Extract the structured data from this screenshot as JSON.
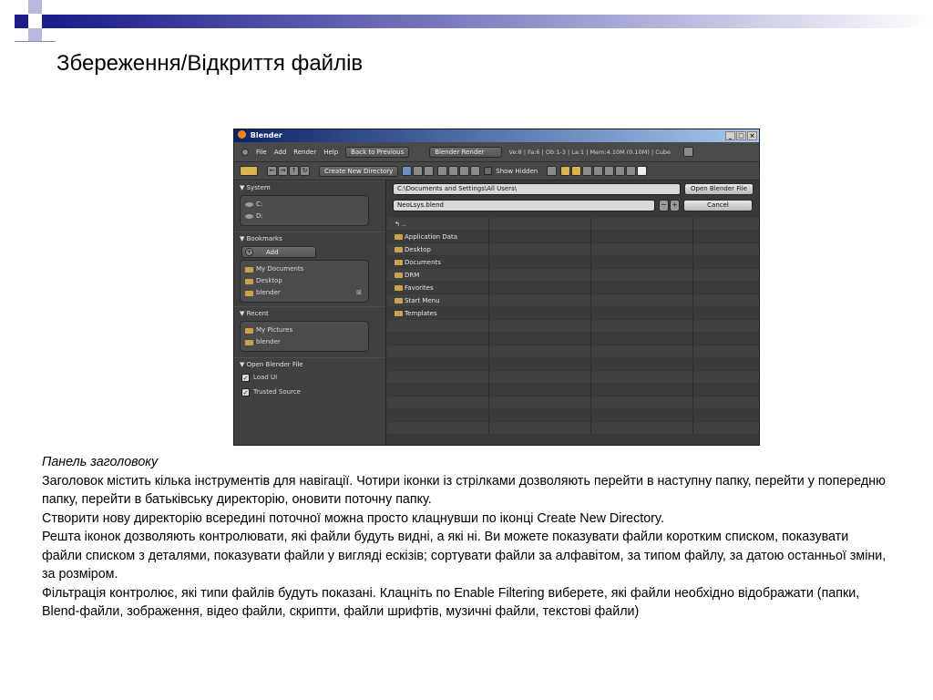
{
  "slide": {
    "title": "Збереження/Відкриття  файлів"
  },
  "window": {
    "title": "Blender",
    "controls": [
      "_",
      "□",
      "×"
    ],
    "menu": {
      "items": [
        "File",
        "Add",
        "Render",
        "Help"
      ],
      "back_button": "Back to Previous",
      "engine": "Blender Render",
      "stats": "Ve:8 | Fa:6 | Ob:1-3 | La:1 | Mem:4.10M (0.10M) | Cube"
    },
    "toolbar": {
      "create_dir_label": "Create New Directory",
      "show_hidden_label": "Show Hidden"
    },
    "sidebar": {
      "system_header": "System",
      "system_items": [
        "C:",
        "D:"
      ],
      "bookmarks_header": "Bookmarks",
      "add_label": "Add",
      "bookmark_items": [
        "My Documents",
        "Desktop",
        "blender"
      ],
      "recent_header": "Recent",
      "recent_items": [
        "My Pictures",
        "blender"
      ],
      "open_header": "Open Blender File",
      "options": [
        {
          "label": "Load UI",
          "checked": true
        },
        {
          "label": "Trusted Source",
          "checked": true
        }
      ]
    },
    "main": {
      "directory": "C:\\Documents and Settings\\All Users\\",
      "filename": "NeoLsys.blend",
      "open_button": "Open Blender File",
      "cancel_button": "Cancel",
      "parent_entry": "..",
      "folders": [
        "Application Data",
        "Desktop",
        "Documents",
        "DRM",
        "Favorites",
        "Start Menu",
        "Templates"
      ]
    }
  },
  "notes": {
    "heading": "Панель заголовоку",
    "lines": [
      "Заголовок містить кілька інструментів для навігації. Чотири іконки із стрілками дозволяють перейти в наступну папку, перейти у попередню папку, перейти в батьківську директорію, оновити поточну папку.",
      "Створити нову директорію всередині поточної можна просто клацнувши по іконці Create New Directory.",
      "Решта іконок дозволяють контролювати, які файли будуть видні, а які ні. Ви можете показувати файли коротким списком, показувати файли списком з деталями, показувати файли у вигляді ескізів; сортувати файли за алфавітом, за типом файлу, за датою останньої зміни, за розміром.",
      "Фільтрація контролює, які типи файлів будуть показані. Клацніть по Enable Filtering виберете, які файли необхідно відображати (папки, Blend-файли, зображення, відео файли, скрипти, файли шрифтів, музичні файли, текстові файли)"
    ]
  },
  "colors": {
    "deco_dark": "#1c1c8c",
    "deco_light": "#b9b9e0",
    "blender_bg": "#3c3c3c"
  }
}
